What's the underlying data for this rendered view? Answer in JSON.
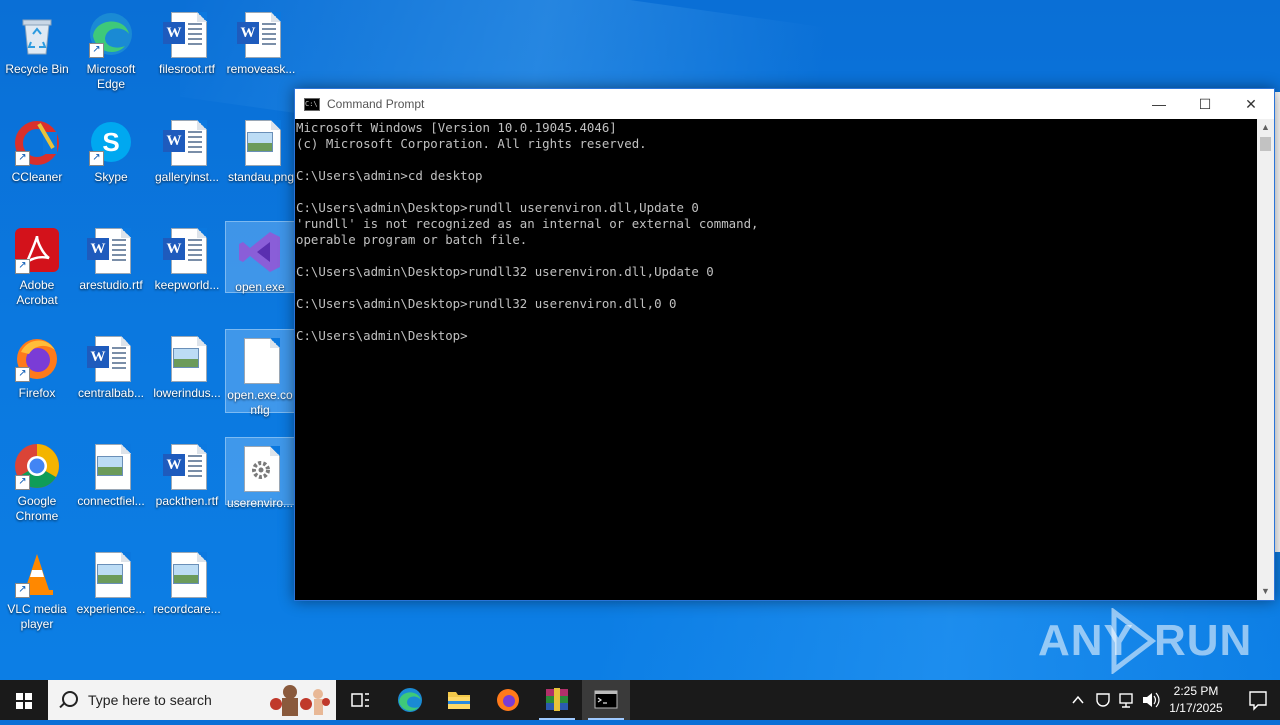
{
  "desktop": {
    "icons": [
      {
        "label": "Recycle Bin"
      },
      {
        "label": "Microsoft Edge"
      },
      {
        "label": "filesroot.rtf"
      },
      {
        "label": "removeask..."
      },
      {
        "label": "CCleaner"
      },
      {
        "label": "Skype"
      },
      {
        "label": "galleryinst..."
      },
      {
        "label": "standau.png"
      },
      {
        "label": "Adobe Acrobat"
      },
      {
        "label": "arestudio.rtf"
      },
      {
        "label": "keepworld..."
      },
      {
        "label": "open.exe"
      },
      {
        "label": "Firefox"
      },
      {
        "label": "centralbab..."
      },
      {
        "label": "lowerindus..."
      },
      {
        "label": "open.exe.config"
      },
      {
        "label": "Google Chrome"
      },
      {
        "label": "connectfiel..."
      },
      {
        "label": "packthen.rtf"
      },
      {
        "label": "userenviro..."
      },
      {
        "label": "VLC media player"
      },
      {
        "label": "experience..."
      },
      {
        "label": "recordcare..."
      }
    ]
  },
  "cmd_window": {
    "title": "Command Prompt",
    "minimize": "—",
    "maximize": "☐",
    "close": "✕",
    "lines": [
      "Microsoft Windows [Version 10.0.19045.4046]",
      "(c) Microsoft Corporation. All rights reserved.",
      "",
      "C:\\Users\\admin>cd desktop",
      "",
      "C:\\Users\\admin\\Desktop>rundll userenviron.dll,Update 0",
      "'rundll' is not recognized as an internal or external command,",
      "operable program or batch file.",
      "",
      "C:\\Users\\admin\\Desktop>rundll32 userenviron.dll,Update 0",
      "",
      "C:\\Users\\admin\\Desktop>rundll32 userenviron.dll,0 0",
      "",
      "C:\\Users\\admin\\Desktop>"
    ]
  },
  "watermark": {
    "left": "ANY",
    "right": "RUN"
  },
  "taskbar": {
    "search_placeholder": "Type here to search",
    "items": [
      "task-view",
      "edge",
      "file-explorer",
      "firefox",
      "winrar",
      "command-prompt"
    ],
    "clock_time": "2:25 PM",
    "clock_date": "1/17/2025"
  },
  "colors": {
    "desktop": "#0b78df",
    "taskbar": "#1a1a1a",
    "console_bg": "#000000",
    "console_text": "#c0c0c0"
  }
}
